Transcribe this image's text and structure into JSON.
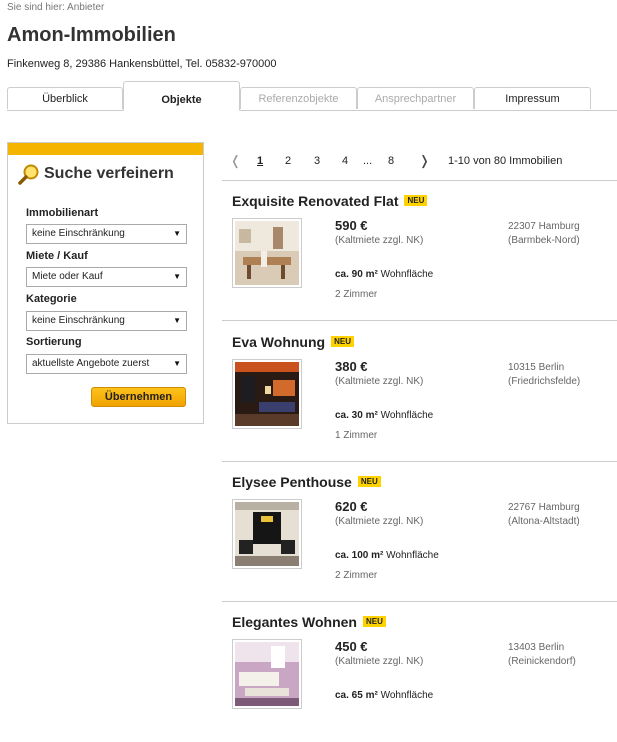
{
  "breadcrumb": "Sie sind hier: Anbieter",
  "company": "Amon-Immobilien",
  "address": "Finkenweg 8, 29386 Hankensbüttel, Tel. 05832-970000",
  "tabs": [
    {
      "label": "Überblick",
      "state": "normal"
    },
    {
      "label": "Objekte",
      "state": "active"
    },
    {
      "label": "Referenzobjekte",
      "state": "disabled"
    },
    {
      "label": "Ansprechpartner",
      "state": "disabled"
    },
    {
      "label": "Impressum",
      "state": "normal"
    }
  ],
  "search": {
    "title": "Suche verfeinern",
    "fields": [
      {
        "label": "Immobilienart",
        "value": "keine Einschränkung"
      },
      {
        "label": "Miete / Kauf",
        "value": "Miete oder Kauf"
      },
      {
        "label": "Kategorie",
        "value": "keine Einschränkung"
      },
      {
        "label": "Sortierung",
        "value": "aktuellste Angebote zuerst"
      }
    ],
    "apply_label": "Übernehmen"
  },
  "pager": {
    "prev": "❬",
    "next": "❭",
    "pages": [
      "1",
      "2",
      "3",
      "4",
      "...",
      "8"
    ],
    "current": "1",
    "summary": "1-10 von 80 Immobilien"
  },
  "listings": [
    {
      "title": "Exquisite Renovated Flat",
      "badge": "NEU",
      "price": "590 €",
      "price_note": "(Kaltmiete zzgl. NK)",
      "area_value": "ca. 90 m²",
      "area_label": "Wohnfläche",
      "rooms": "2 Zimmer",
      "zip_city": "22307 Hamburg",
      "district": "(Barmbek-Nord)"
    },
    {
      "title": "Eva Wohnung",
      "badge": "NEU",
      "price": "380 €",
      "price_note": "(Kaltmiete zzgl. NK)",
      "area_value": "ca. 30 m²",
      "area_label": "Wohnfläche",
      "rooms": "1 Zimmer",
      "zip_city": "10315 Berlin",
      "district": "(Friedrichsfelde)"
    },
    {
      "title": "Elysee Penthouse",
      "badge": "NEU",
      "price": "620 €",
      "price_note": "(Kaltmiete zzgl. NK)",
      "area_value": "ca. 100 m²",
      "area_label": "Wohnfläche",
      "rooms": "2 Zimmer",
      "zip_city": "22767 Hamburg",
      "district": "(Altona-Altstadt)"
    },
    {
      "title": "Elegantes Wohnen",
      "badge": "NEU",
      "price": "450 €",
      "price_note": "(Kaltmiete zzgl. NK)",
      "area_value": "ca. 65 m²",
      "area_label": "Wohnfläche",
      "rooms": "",
      "zip_city": "13403 Berlin",
      "district": "(Reinickendorf)"
    }
  ],
  "colors": {
    "accent": "#f5b400",
    "badge": "#ffd200"
  }
}
